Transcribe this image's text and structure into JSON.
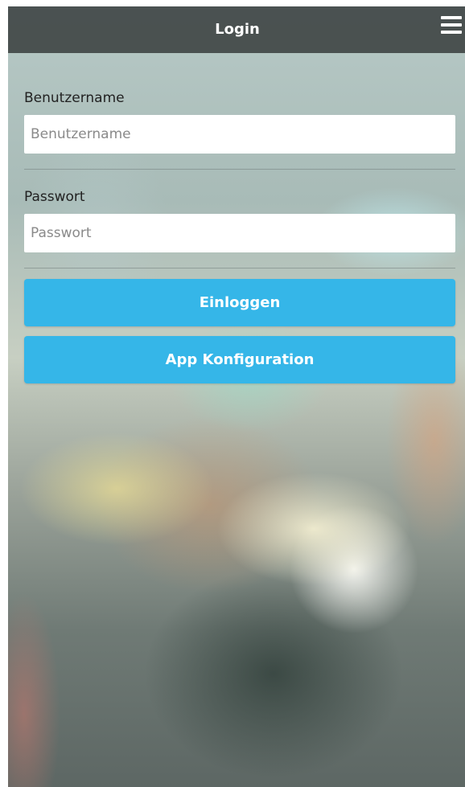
{
  "header": {
    "title": "Login",
    "menu_icon": "hamburger-menu-icon"
  },
  "form": {
    "username": {
      "label": "Benutzername",
      "placeholder": "Benutzername",
      "value": ""
    },
    "password": {
      "label": "Passwort",
      "placeholder": "Passwort",
      "value": ""
    }
  },
  "buttons": {
    "login_label": "Einloggen",
    "config_label": "App Konfiguration"
  },
  "colors": {
    "header_background": "#323737",
    "button_accent": "#35b6e8"
  }
}
